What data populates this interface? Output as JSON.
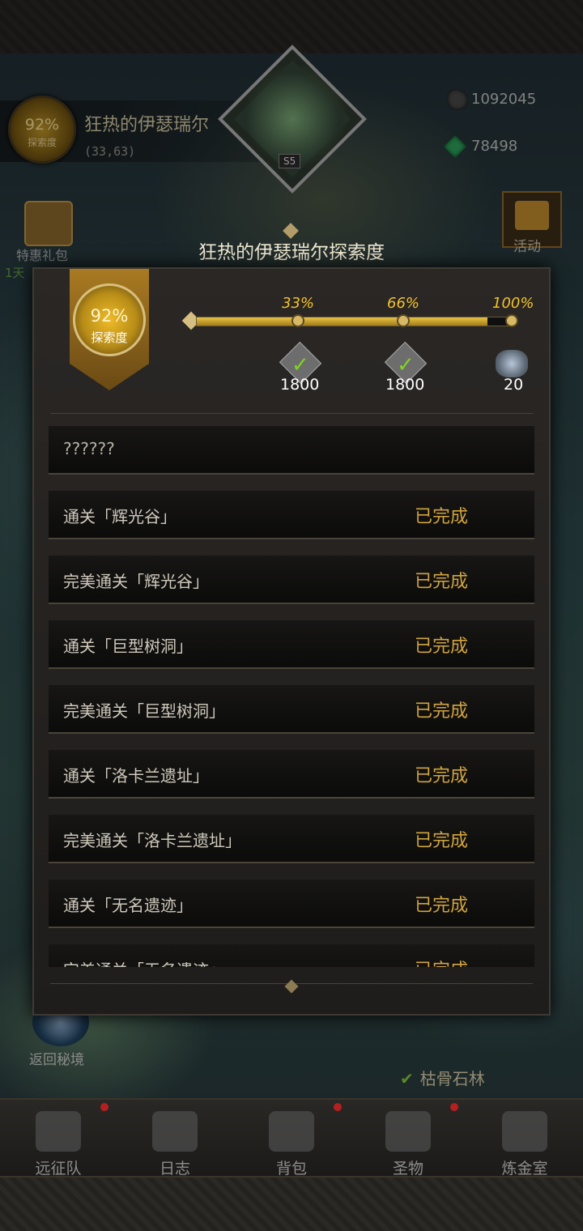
{
  "hud": {
    "exploration_percent": "92%",
    "exploration_label": "探索度",
    "location_name": "狂热的伊瑟瑞尔",
    "coordinates": "(33,63)",
    "portrait_level": "S5",
    "currency_dark": "1092045",
    "currency_green": "78498",
    "gift_label": "特惠礼包",
    "gift_timer": "1天",
    "event_label": "活动",
    "return_label": "返回秘境",
    "region_tag": "枯骨石林"
  },
  "modal": {
    "title": "狂热的伊瑟瑞尔探索度",
    "banner_percent": "92%",
    "banner_label": "探索度",
    "progress": 0.92,
    "milestones": [
      {
        "percent": "33%",
        "reward_qty": "1800",
        "claimed": true
      },
      {
        "percent": "66%",
        "reward_qty": "1800",
        "claimed": true
      },
      {
        "percent": "100%",
        "reward_qty": "20",
        "claimed": false
      }
    ],
    "tasks": [
      {
        "name": "??????",
        "status": ""
      },
      {
        "name": "通关「辉光谷」",
        "status": "已完成"
      },
      {
        "name": "完美通关「辉光谷」",
        "status": "已完成"
      },
      {
        "name": "通关「巨型树洞」",
        "status": "已完成"
      },
      {
        "name": "完美通关「巨型树洞」",
        "status": "已完成"
      },
      {
        "name": "通关「洛卡兰遗址」",
        "status": "已完成"
      },
      {
        "name": "完美通关「洛卡兰遗址」",
        "status": "已完成"
      },
      {
        "name": "通关「无名遗迹」",
        "status": "已完成"
      },
      {
        "name": "完美通关「无名遗迹」",
        "status": "已完成"
      }
    ]
  },
  "nav": {
    "items": [
      {
        "label": "远征队",
        "icon": "helmet-icon",
        "dot": true
      },
      {
        "label": "日志",
        "icon": "scroll-icon",
        "dot": false
      },
      {
        "label": "背包",
        "icon": "backpack-icon",
        "dot": true
      },
      {
        "label": "圣物",
        "icon": "relic-icon",
        "dot": true
      },
      {
        "label": "炼金室",
        "icon": "alchemy-icon",
        "dot": false
      }
    ]
  }
}
